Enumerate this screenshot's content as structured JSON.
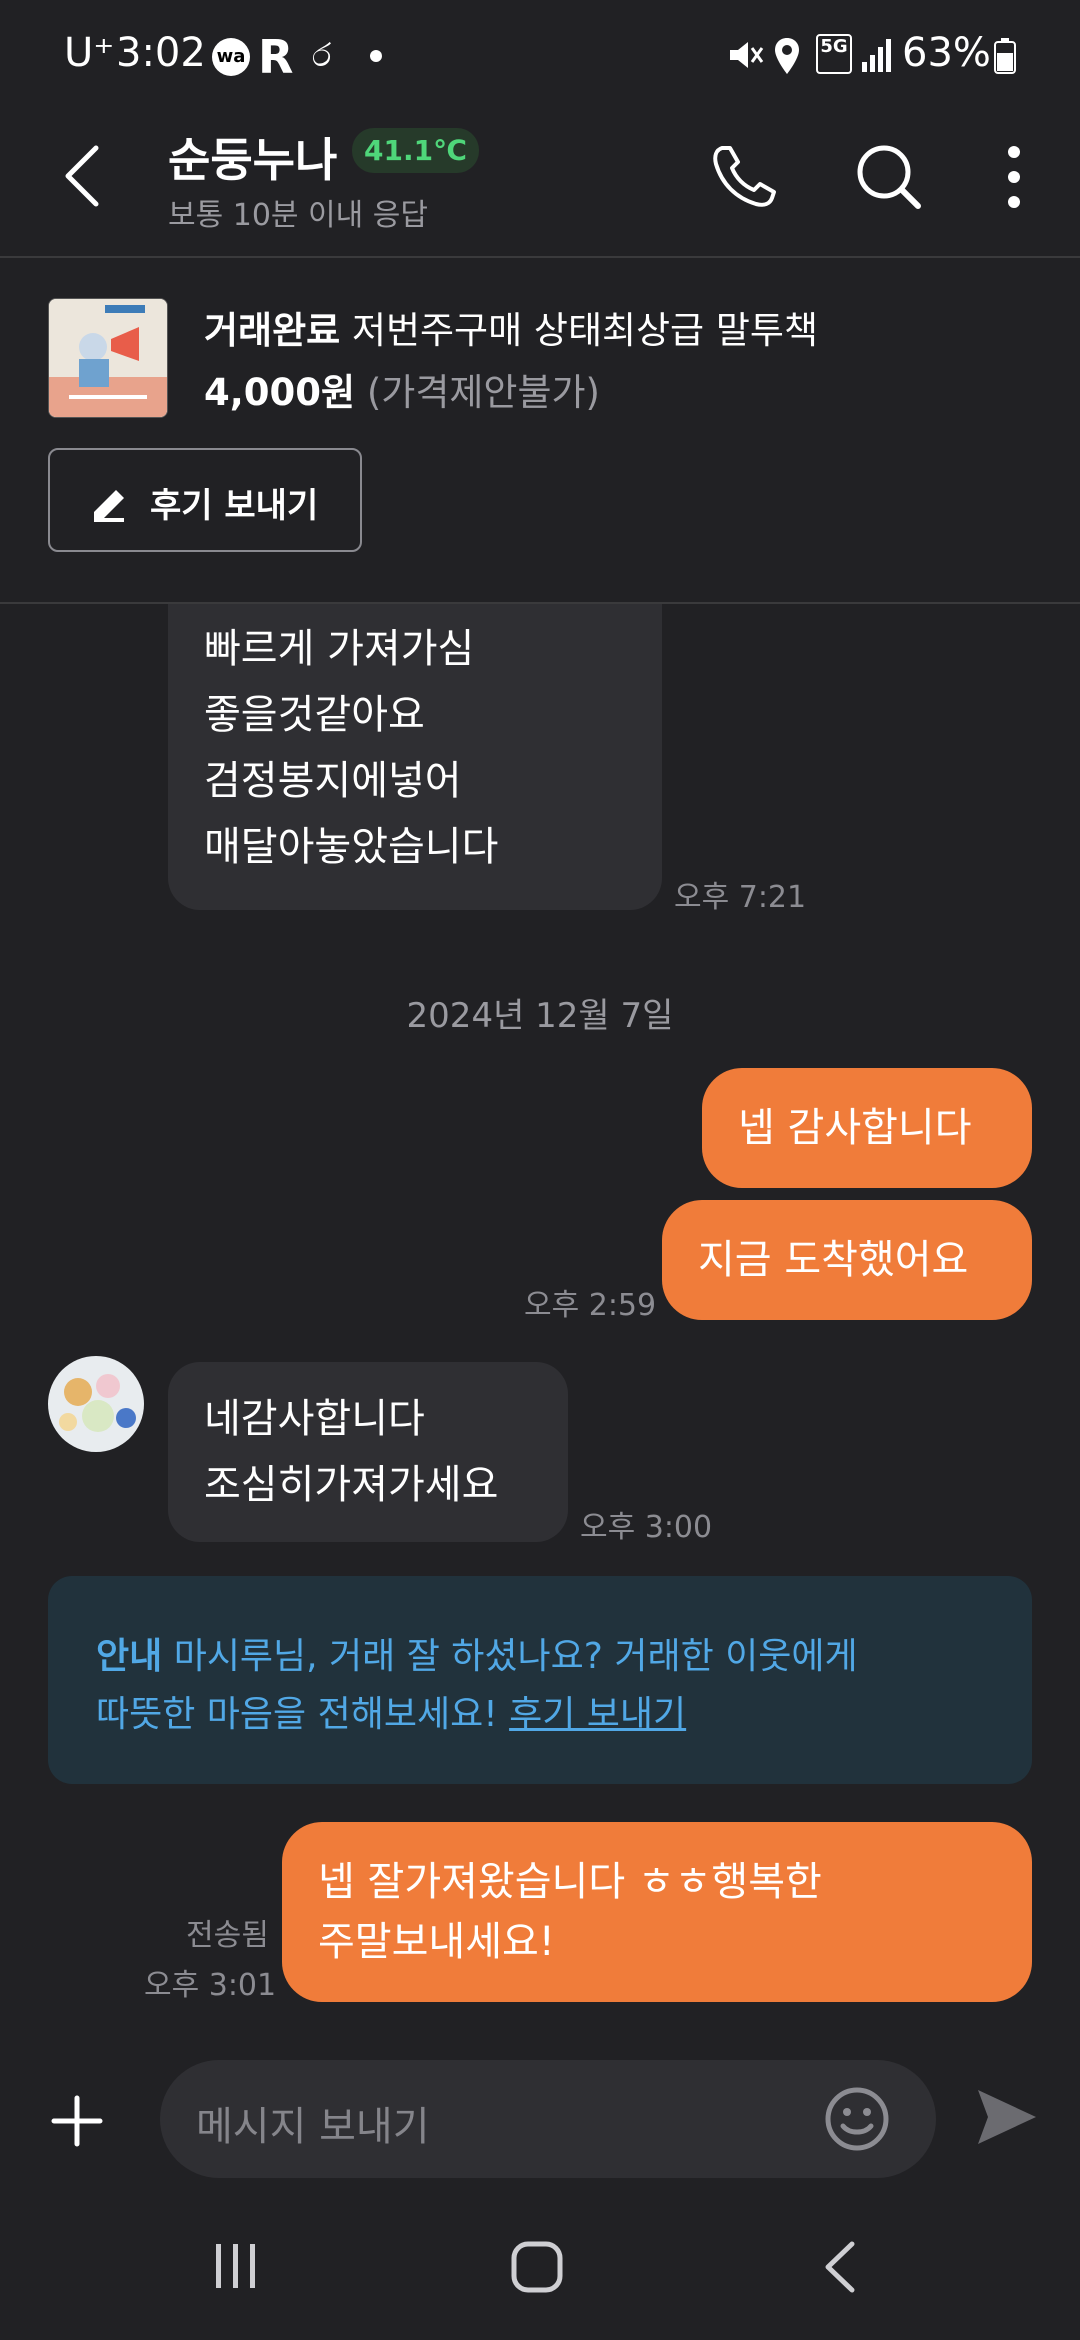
{
  "status_bar": {
    "carrier": "U⁺",
    "time": "3:02",
    "network": "5G",
    "battery": "63%"
  },
  "header": {
    "seller_name": "순둥누나",
    "manner_temp": "41.1℃",
    "response_time": "보통 10분 이내 응답"
  },
  "product": {
    "status": "거래완료",
    "title": "저번주구매 상태최상급 말투책",
    "price": "4,000원",
    "price_note": "(가격제안불가)",
    "review_button": "후기 보내기"
  },
  "messages": {
    "msg1_line1": "빠르게 가져가심",
    "msg1_line2": "좋을것같아요",
    "msg1_line3": "검정봉지에넣어",
    "msg1_line4": "매달아놓았습니다",
    "msg1_time": "오후 7:21",
    "date_divider": "2024년 12월 7일",
    "msg2": "넵 감사합니다",
    "msg3": "지금 도착했어요",
    "msg3_time": "오후 2:59",
    "msg4_line1": "네감사합니다",
    "msg4_line2": "조심히가져가세요",
    "msg4_time": "오후 3:00",
    "notice_label": "안내",
    "notice_text1": " 마시루님, 거래 잘 하셨나요? 거래한 이웃에게",
    "notice_text2": "따뜻한 마음을 전해보세요! ",
    "notice_link": "후기 보내기",
    "msg5_line1": "넵 잘가져왔습니다 ㅎㅎ행복한",
    "msg5_line2": "주말보내세요!",
    "msg5_status": "전송됨",
    "msg5_time": "오후 3:01"
  },
  "input": {
    "placeholder": "메시지 보내기"
  },
  "colors": {
    "background": "#212124",
    "accent_orange": "#f07c3a",
    "temp_green": "#4fd67a",
    "notice_blue": "#51a8e6"
  }
}
